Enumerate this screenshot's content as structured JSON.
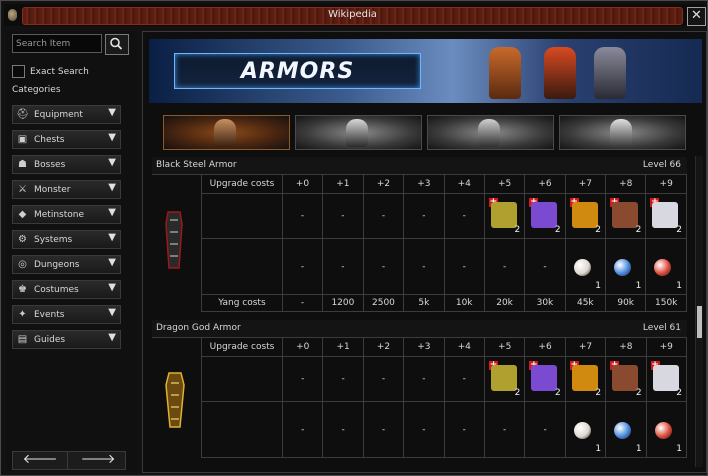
{
  "window": {
    "title": "Wikipedia"
  },
  "sidebar": {
    "search_placeholder": "Search Item",
    "exact_search_label": "Exact Search",
    "categories_label": "Categories",
    "categories": [
      {
        "label": "Equipment",
        "icon": "helmet-icon"
      },
      {
        "label": "Chests",
        "icon": "chest-icon"
      },
      {
        "label": "Bosses",
        "icon": "boss-icon"
      },
      {
        "label": "Monster",
        "icon": "sword-icon"
      },
      {
        "label": "Metinstone",
        "icon": "metinstone-icon"
      },
      {
        "label": "Systems",
        "icon": "gear-icon"
      },
      {
        "label": "Dungeons",
        "icon": "portal-icon"
      },
      {
        "label": "Costumes",
        "icon": "costume-icon"
      },
      {
        "label": "Events",
        "icon": "event-icon"
      },
      {
        "label": "Guides",
        "icon": "book-icon"
      }
    ]
  },
  "banner": {
    "title": "ARMORS"
  },
  "columns": [
    "Upgrade costs",
    "+0",
    "+1",
    "+2",
    "+3",
    "+4",
    "+5",
    "+6",
    "+7",
    "+8",
    "+9"
  ],
  "items": [
    {
      "name": "Black Steel Armor",
      "level": "Level 66",
      "row1": [
        "-",
        "-",
        "-",
        "-",
        "-",
        "2",
        "2",
        "2",
        "2",
        "2"
      ],
      "row2": [
        "-",
        "-",
        "-",
        "-",
        "-",
        "-",
        "-",
        "1",
        "1",
        "1"
      ],
      "yang_label": "Yang costs",
      "yang": [
        "-",
        "1200",
        "2500",
        "5k",
        "10k",
        "20k",
        "30k",
        "45k",
        "90k",
        "150k"
      ]
    },
    {
      "name": "Dragon God Armor",
      "level": "Level 61",
      "row1": [
        "-",
        "-",
        "-",
        "-",
        "-",
        "2",
        "2",
        "2",
        "2",
        "2"
      ],
      "row2": [
        "-",
        "-",
        "-",
        "-",
        "-",
        "-",
        "-",
        "1",
        "1",
        "1"
      ]
    }
  ],
  "colors": {
    "titlebar": "#5a1d12",
    "banner": "#3b5b8c",
    "plus_badge": "#d01a1a"
  }
}
